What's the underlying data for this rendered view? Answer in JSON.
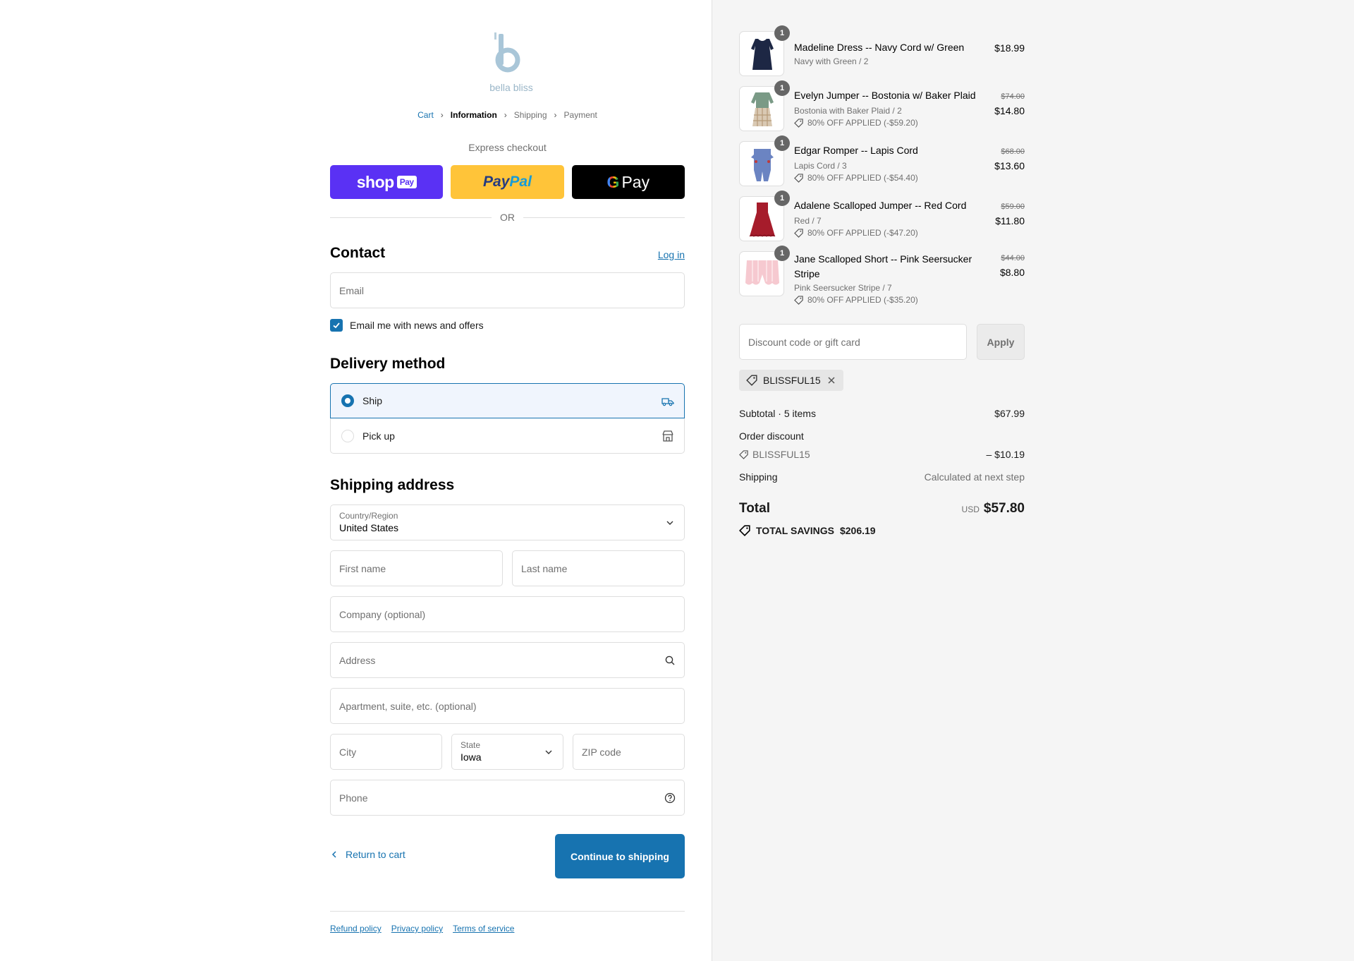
{
  "brand": {
    "name": "bella bliss",
    "accent": "#1773b0"
  },
  "breadcrumb": [
    {
      "label": "Cart"
    },
    {
      "label": "Information"
    },
    {
      "label": "Shipping"
    },
    {
      "label": "Payment"
    }
  ],
  "express": {
    "title": "Express checkout",
    "shop_pay": {
      "text": "shop",
      "badge": "Pay"
    },
    "paypal": {
      "part1": "Pay",
      "part2": "Pal"
    },
    "gpay": {
      "g": "G",
      "text": "Pay"
    },
    "or": "OR"
  },
  "contact": {
    "title": "Contact",
    "login": "Log in",
    "email_placeholder": "Email",
    "newsletter_label": "Email me with news and offers",
    "newsletter_checked": true
  },
  "delivery": {
    "title": "Delivery method",
    "options": [
      {
        "label": "Ship",
        "selected": true
      },
      {
        "label": "Pick up",
        "selected": false
      }
    ]
  },
  "shipping_address": {
    "title": "Shipping address",
    "country_label": "Country/Region",
    "country_value": "United States",
    "first_name": "First name",
    "last_name": "Last name",
    "company": "Company (optional)",
    "address": "Address",
    "apartment": "Apartment, suite, etc. (optional)",
    "city": "City",
    "state_label": "State",
    "state_value": "Iowa",
    "zip": "ZIP code",
    "phone": "Phone"
  },
  "actions": {
    "back": "Return to cart",
    "continue": "Continue to shipping"
  },
  "footer": {
    "refund": "Refund policy",
    "privacy": "Privacy policy",
    "terms": "Terms of service"
  },
  "order": {
    "items": [
      {
        "name": "Madeline Dress -- Navy Cord w/ Green",
        "variant": "Navy with Green / 2",
        "qty": "1",
        "price": "$18.99",
        "old_price": "",
        "discount": ""
      },
      {
        "name": "Evelyn Jumper -- Bostonia w/ Baker Plaid",
        "variant": "Bostonia with Baker Plaid / 2",
        "qty": "1",
        "price": "$14.80",
        "old_price": "$74.00",
        "discount": "80% OFF APPLIED (-$59.20)"
      },
      {
        "name": "Edgar Romper -- Lapis Cord",
        "variant": "Lapis Cord / 3",
        "qty": "1",
        "price": "$13.60",
        "old_price": "$68.00",
        "discount": "80% OFF APPLIED (-$54.40)"
      },
      {
        "name": "Adalene Scalloped Jumper -- Red Cord",
        "variant": "Red / 7",
        "qty": "1",
        "price": "$11.80",
        "old_price": "$59.00",
        "discount": "80% OFF APPLIED (-$47.20)"
      },
      {
        "name": "Jane Scalloped Short -- Pink Seersucker Stripe",
        "variant": "Pink Seersucker Stripe / 7",
        "qty": "1",
        "price": "$8.80",
        "old_price": "$44.00",
        "discount": "80% OFF APPLIED (-$35.20)"
      }
    ],
    "discount_placeholder": "Discount code or gift card",
    "apply": "Apply",
    "applied_code": "BLISSFUL15",
    "subtotal_label": "Subtotal · 5 items",
    "subtotal": "$67.99",
    "order_discount_label": "Order discount",
    "order_discount_code": "BLISSFUL15",
    "order_discount_value": "– $10.19",
    "shipping_label": "Shipping",
    "shipping_value": "Calculated at next step",
    "total_label": "Total",
    "currency": "USD",
    "total": "$57.80",
    "savings_label": "TOTAL SAVINGS",
    "savings_value": "$206.19"
  }
}
